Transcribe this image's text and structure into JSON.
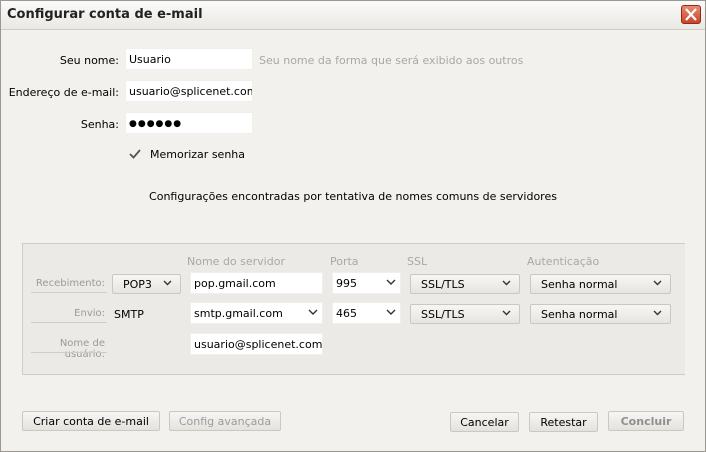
{
  "window": {
    "title": "Configurar conta de e-mail"
  },
  "form": {
    "name_label": "Seu nome:",
    "name_value": "Usuario",
    "name_hint": "Seu nome da forma que será exibido aos outros",
    "email_label": "Endereço de e-mail:",
    "email_value": "usuario@splicenet.com.br",
    "password_label": "Senha:",
    "password_value": "●●●●●●",
    "remember_label": "Memorizar senha",
    "remember_checked": true
  },
  "status_message": "Configurações encontradas por tentativa de nomes comuns de servidores",
  "server": {
    "headers": {
      "server_name": "Nome do servidor",
      "port": "Porta",
      "ssl": "SSL",
      "auth": "Autenticação"
    },
    "incoming": {
      "label": "Recebimento:",
      "protocol": "POP3",
      "hostname": "pop.gmail.com",
      "port": "995",
      "ssl": "SSL/TLS",
      "auth": "Senha normal"
    },
    "outgoing": {
      "label": "Envio:",
      "protocol": "SMTP",
      "hostname": "smtp.gmail.com",
      "port": "465",
      "ssl": "SSL/TLS",
      "auth": "Senha normal"
    },
    "username_label": "Nome de usuário:",
    "username_value": "usuario@splicenet.com.br"
  },
  "buttons": {
    "create": "Criar conta de e-mail",
    "advanced": "Config avançada",
    "cancel": "Cancelar",
    "retest": "Retestar",
    "done": "Concluir"
  }
}
